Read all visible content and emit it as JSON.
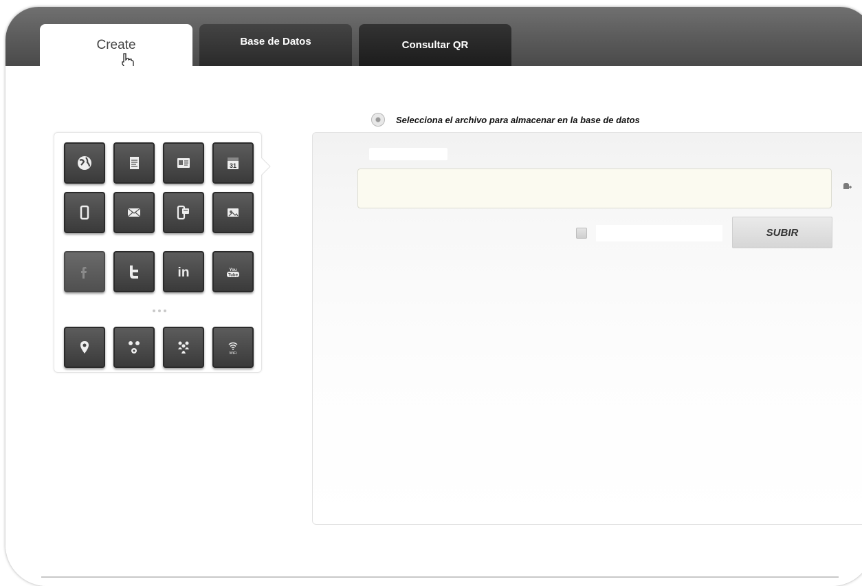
{
  "tabs": [
    {
      "label": "Create",
      "active": true
    },
    {
      "label": "Base de Datos",
      "active": false
    },
    {
      "label": "Consultar QR",
      "active": false
    }
  ],
  "palette": {
    "rows": [
      [
        "globe-icon",
        "document-icon",
        "id-card-icon",
        "calendar-icon"
      ],
      [
        "mobile-phone-icon",
        "envelope-icon",
        "sms-icon",
        "photo-card-icon"
      ],
      [
        "facebook-icon",
        "twitter-icon",
        "linkedin-icon",
        "youtube-icon"
      ],
      [
        "location-pin-icon",
        "share-icon",
        "people-icon",
        "wifi-icon"
      ]
    ],
    "calendar_day": "31",
    "linkedin_text": "in",
    "youtube_text": "You Tube",
    "wifi_text": "WiFi"
  },
  "upload": {
    "instruction": "Selecciona el archivo para almacenar en la base de datos",
    "file_value": "",
    "submit_label": "SUBIR"
  },
  "colors": {
    "header_bar": "#5a5a5a",
    "tab_dark": "#2a2a2a",
    "input_bg": "#fbfaf0",
    "icon_tile": "#3a3a3a"
  }
}
